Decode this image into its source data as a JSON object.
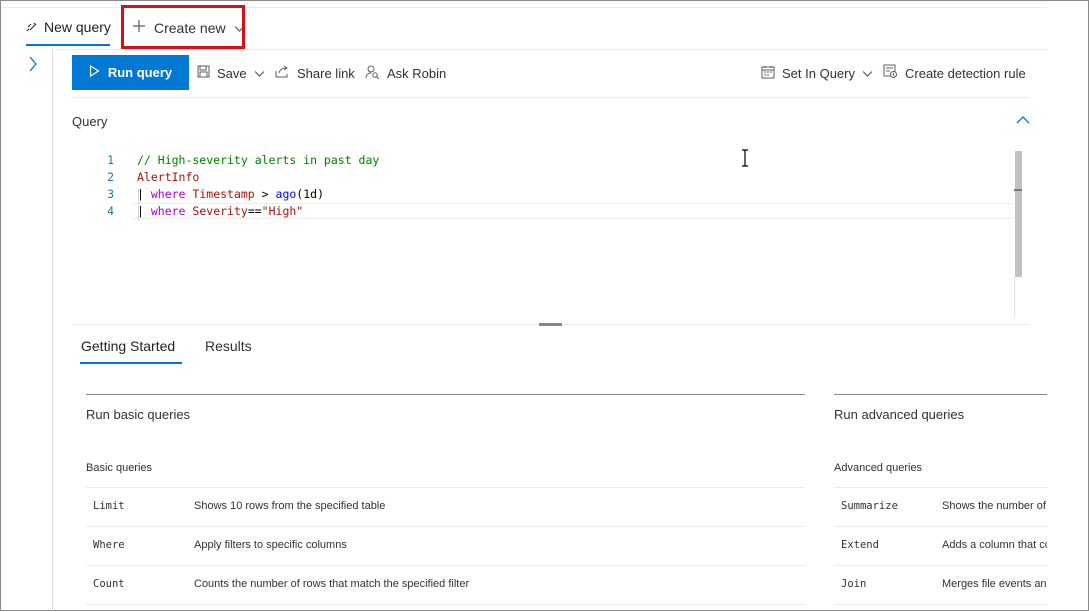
{
  "tabs": {
    "new_query": "New query",
    "create_new": "Create new"
  },
  "toolbar": {
    "run_query": "Run query",
    "save": "Save",
    "share_link": "Share link",
    "ask_robin": "Ask Robin",
    "set_in_query": "Set In Query",
    "create_detection_rule": "Create detection rule"
  },
  "query": {
    "label": "Query",
    "line_numbers": [
      "1",
      "2",
      "3",
      "4"
    ],
    "line1_comment": "// High-severity alerts in past day",
    "line2_table": "AlertInfo",
    "line3": {
      "pipe": "| ",
      "kw": "where",
      "col": "Timestamp",
      "op": " > ",
      "fn": "ago",
      "arg": "(1d)"
    },
    "line4": {
      "pipe": "| ",
      "kw": "where",
      "col": "Severity",
      "op": "==",
      "str": "\"High\""
    }
  },
  "bottom_tabs": {
    "getting_started": "Getting Started",
    "results": "Results"
  },
  "basic": {
    "title": "Run basic queries",
    "subtitle": "Basic queries",
    "rows": [
      {
        "name": "Limit",
        "desc": "Shows 10 rows from the specified table"
      },
      {
        "name": "Where",
        "desc": "Apply filters to specific columns"
      },
      {
        "name": "Count",
        "desc": "Counts the number of rows that match the specified filter"
      }
    ]
  },
  "advanced": {
    "title": "Run advanced queries",
    "subtitle": "Advanced queries",
    "rows": [
      {
        "name": "Summarize",
        "desc": "Shows the number of events"
      },
      {
        "name": "Extend",
        "desc": "Adds a column that contains"
      },
      {
        "name": "Join",
        "desc": "Merges file events and"
      }
    ]
  },
  "colors": {
    "accent": "#0078d4",
    "highlight": "#d1121c"
  }
}
